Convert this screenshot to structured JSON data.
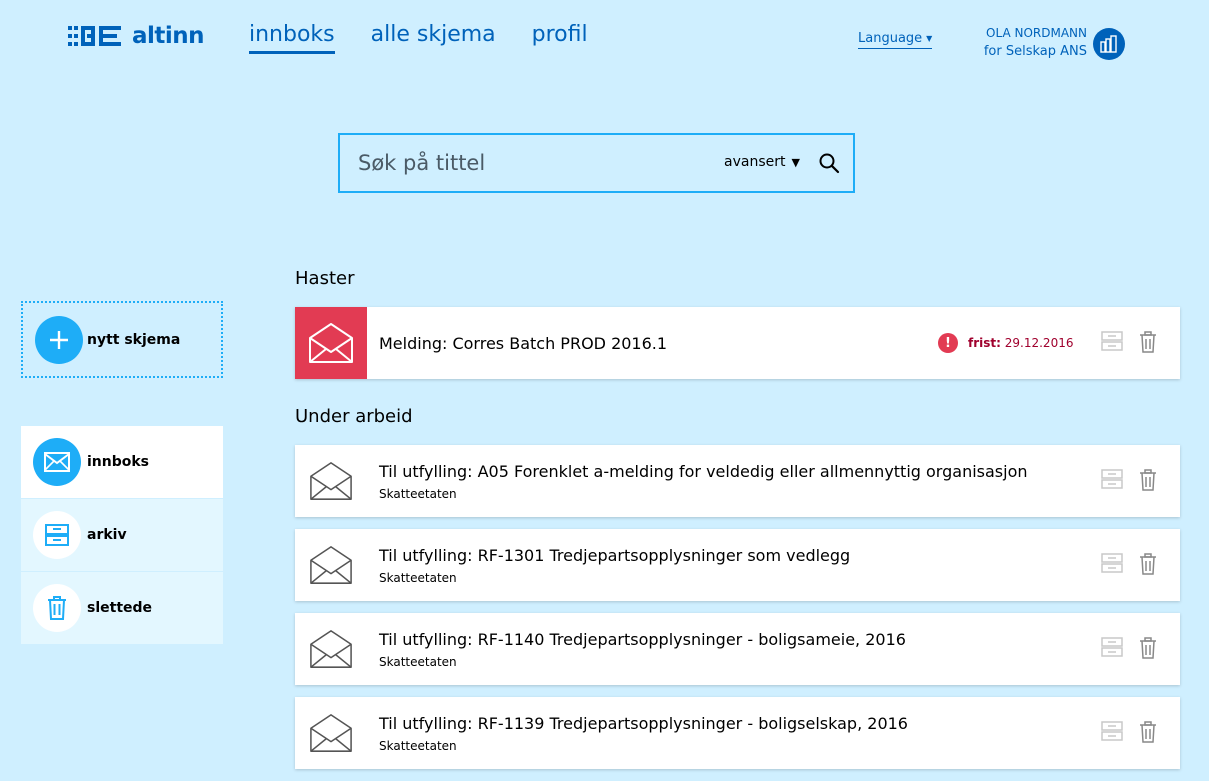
{
  "header": {
    "logo_text": "altinn",
    "nav": [
      {
        "label": "innboks",
        "active": true
      },
      {
        "label": "alle skjema",
        "active": false
      },
      {
        "label": "profil",
        "active": false
      }
    ],
    "language_label": "Language",
    "user_name": "OLA NORDMANN",
    "user_org": "for Selskap ANS"
  },
  "search": {
    "placeholder": "Søk på tittel",
    "advanced_label": "avansert"
  },
  "sidebar": {
    "new_form_label": "nytt skjema",
    "items": [
      {
        "label": "innboks",
        "icon": "envelope-icon",
        "active": true
      },
      {
        "label": "arkiv",
        "icon": "archive-icon",
        "active": false
      },
      {
        "label": "slettede",
        "icon": "trash-icon",
        "active": false
      }
    ]
  },
  "sections": {
    "urgent_title": "Haster",
    "in_progress_title": "Under arbeid"
  },
  "urgent_messages": [
    {
      "title": "Melding: Corres Batch PROD 2016.1",
      "deadline_label": "frist:",
      "deadline_date": "29.12.2016"
    }
  ],
  "messages": [
    {
      "title": "Til utfylling: A05 Forenklet a-melding for veldedig eller allmennyttig organisasjon",
      "sender": "Skatteetaten"
    },
    {
      "title": "Til utfylling: RF-1301 Tredjepartsopplysninger som vedlegg",
      "sender": "Skatteetaten"
    },
    {
      "title": "Til utfylling: RF-1140 Tredjepartsopplysninger - boligsameie, 2016",
      "sender": "Skatteetaten"
    },
    {
      "title": "Til utfylling: RF-1139 Tredjepartsopplysninger - boligselskap, 2016",
      "sender": "Skatteetaten"
    }
  ],
  "colors": {
    "background": "#cfefff",
    "brand_blue": "#0062ba",
    "accent_blue": "#1eadf7",
    "urgent_red": "#e23b53",
    "deadline_text": "#a0002d"
  }
}
